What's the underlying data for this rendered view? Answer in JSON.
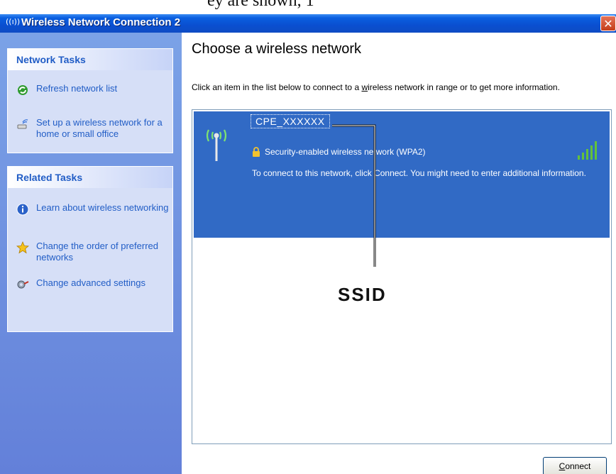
{
  "top_strip": {
    "cut_text": "ey are shown, 1"
  },
  "window": {
    "title": "Wireless Network Connection 2",
    "title_icon": "((ı))",
    "close_label": "✕"
  },
  "left_pane": {
    "network_tasks": {
      "heading": "Network Tasks",
      "items": [
        {
          "label": "Refresh network list",
          "icon": "refresh-icon"
        },
        {
          "label": "Set up a wireless network for a home or small office",
          "icon": "setup-wireless-icon"
        }
      ]
    },
    "related_tasks": {
      "heading": "Related Tasks",
      "items": [
        {
          "label": "Learn about wireless networking",
          "icon": "info-icon"
        },
        {
          "label": "Change the order of preferred networks",
          "icon": "star-icon"
        },
        {
          "label": "Change advanced settings",
          "icon": "settings-icon"
        }
      ]
    }
  },
  "main": {
    "heading": "Choose a wireless network",
    "instruction_pre": "Click an item in the list below to connect to a ",
    "instruction_link": "w",
    "instruction_post": "ireless network in range or to get more information.",
    "networks": [
      {
        "ssid": "CPE_XXXXXX",
        "security": "Security-enabled wireless network (WPA2)",
        "description": "To connect to this network, click Connect. You might need to enter additional information.",
        "signal_strength": "5 of 5 bars"
      }
    ],
    "connect_button": {
      "underlined": "C",
      "rest": "onnect"
    }
  },
  "annotation": {
    "label": "SSID"
  },
  "colors": {
    "titlebar": "#0a4fd0",
    "left_pane": "#6f91de",
    "selected_item": "#316ac5",
    "task_link": "#215dc6",
    "signal_bars": "#63c23a"
  }
}
